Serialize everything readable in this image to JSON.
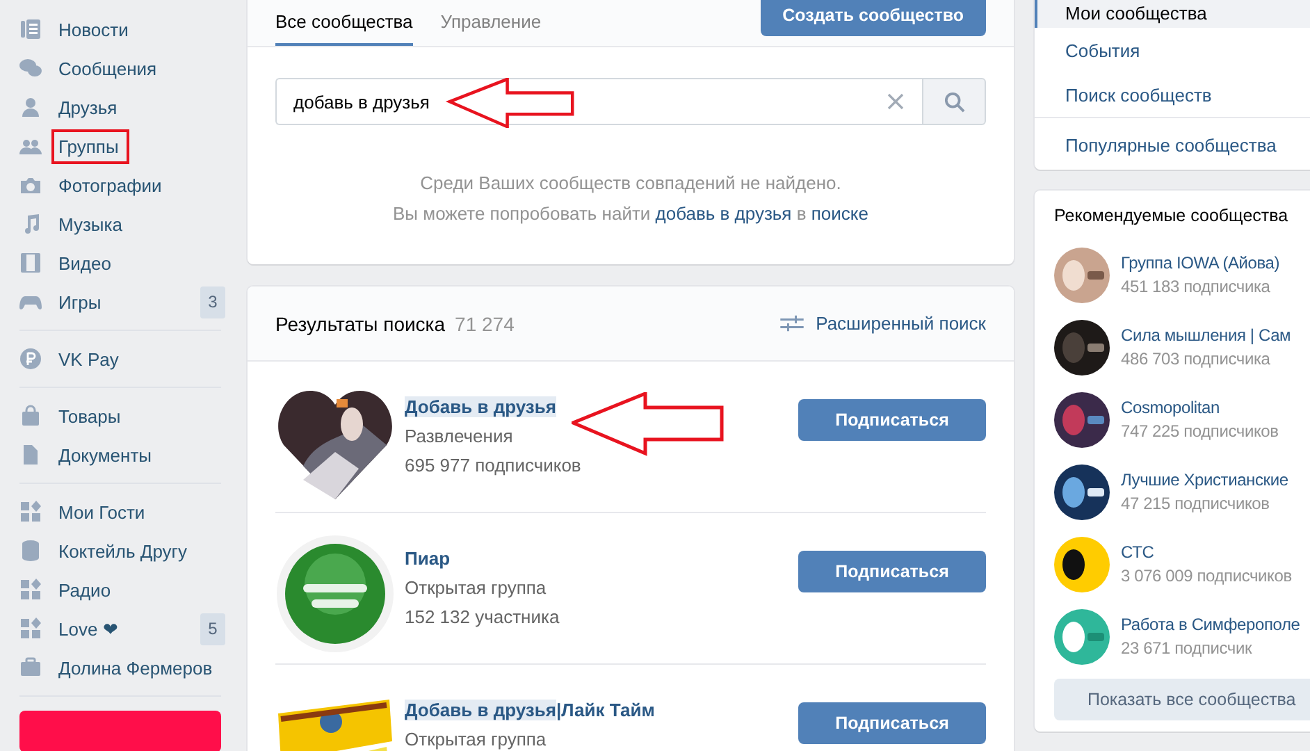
{
  "sidebar": {
    "groups": [
      {
        "items": [
          {
            "label": "Новости",
            "boxed": false
          },
          {
            "label": "Сообщения",
            "boxed": false
          },
          {
            "label": "Друзья",
            "boxed": false
          },
          {
            "label": "Группы",
            "boxed": true
          },
          {
            "label": "Фотографии",
            "boxed": false
          },
          {
            "label": "Музыка",
            "boxed": false
          },
          {
            "label": "Видео",
            "boxed": false
          },
          {
            "label": "Игры",
            "boxed": false,
            "badge": "3"
          }
        ]
      },
      {
        "items": [
          {
            "label": "VK Pay",
            "boxed": false
          }
        ]
      },
      {
        "items": [
          {
            "label": "Товары",
            "boxed": false
          },
          {
            "label": "Документы",
            "boxed": false
          }
        ]
      },
      {
        "items": [
          {
            "label": "Мои Гости",
            "boxed": false
          },
          {
            "label": "Коктейль Другу",
            "boxed": false
          },
          {
            "label": "Радио",
            "boxed": false
          },
          {
            "label": "Love ❤",
            "boxed": false,
            "badge": "5"
          },
          {
            "label": "Долина Фермеров",
            "boxed": false
          }
        ]
      }
    ]
  },
  "main": {
    "tabs": [
      {
        "label": "Все сообщества",
        "selected": true
      },
      {
        "label": "Управление",
        "selected": false
      }
    ],
    "create_button": "Создать сообщество",
    "search": {
      "value": "добавь в друзья"
    },
    "no_results": {
      "line1": "Среди Ваших сообществ совпадений не найдено.",
      "line2_prefix": "Вы можете попробовать найти ",
      "query_link": "добавь в друзья",
      "line2_middle": " в ",
      "search_link": "поиске"
    },
    "results": {
      "title": "Результаты поиска",
      "count": "71 274",
      "advanced_search": "Расширенный поиск",
      "items": [
        {
          "title_parts": [
            {
              "text": "Добавь в друзья",
              "highlight": true
            }
          ],
          "category": "Развлечения",
          "members": "695 977 подписчиков",
          "button": "Подписаться"
        },
        {
          "title_parts": [
            {
              "text": "Пиар",
              "highlight": false
            }
          ],
          "category": "Открытая группа",
          "members": "152 132 участника",
          "button": "Подписаться"
        },
        {
          "title_parts": [
            {
              "text": "Добавь в друзья",
              "highlight": true
            },
            {
              "text": "|Лайк Тайм",
              "highlight": false
            }
          ],
          "category": "Открытая группа",
          "button": "Подписаться"
        }
      ]
    }
  },
  "right": {
    "menu_groups": [
      {
        "items": [
          {
            "label": "Мои сообщества",
            "selected": true
          },
          {
            "label": "События",
            "selected": false
          },
          {
            "label": "Поиск сообществ",
            "selected": false
          }
        ]
      },
      {
        "items": [
          {
            "label": "Популярные сообщества",
            "selected": false
          }
        ]
      }
    ],
    "recommended": {
      "title": "Рекомендуемые сообщества",
      "items": [
        {
          "name": "Группа IOWA (Айова)",
          "subscribers": "451 183 подписчика"
        },
        {
          "name": "Сила мышления | Сам",
          "subscribers": "486 703 подписчика"
        },
        {
          "name": "Cosmopolitan",
          "subscribers": "747 225 подписчиков"
        },
        {
          "name": "Лучшие Христианские",
          "subscribers": "47 215 подписчиков"
        },
        {
          "name": "СТС",
          "subscribers": "3 076 009 подписчиков"
        },
        {
          "name": "Работа в Симферополе",
          "subscribers": "23 671 подписчик"
        }
      ],
      "show_all": "Показать все сообщества"
    }
  }
}
